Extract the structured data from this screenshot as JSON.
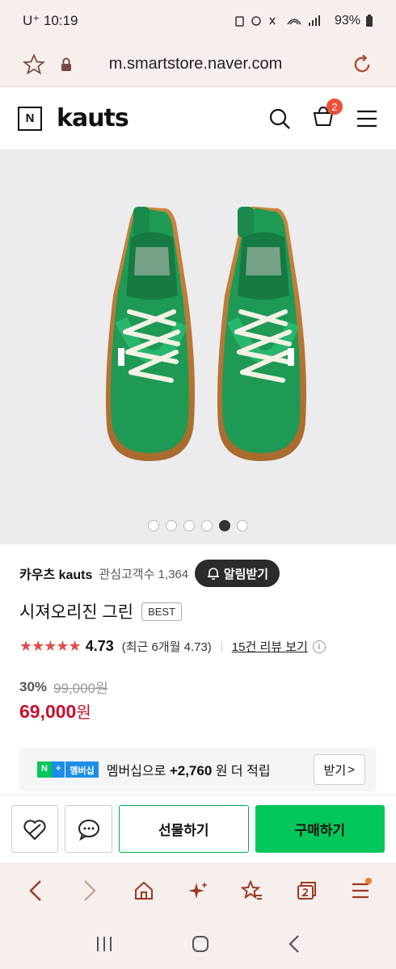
{
  "status": {
    "carrier_time": "U⁺ 10:19",
    "battery": "93%"
  },
  "browser": {
    "url": "m.smartstore.naver.com"
  },
  "header": {
    "n_logo": "N",
    "brand": "kauts",
    "cart_count": "2"
  },
  "gallery": {
    "total_images": 6,
    "active_index": 5
  },
  "store": {
    "name": "카우츠 kauts",
    "followers": "관심고객수 1,364",
    "alarm_label": "알림받기"
  },
  "product": {
    "title": "시져오리진 그린",
    "badge": "BEST",
    "stars": "★★★★★",
    "rating": "4.73",
    "recent_rating": "(최근 6개월 4.73)",
    "reviews_link": "15건 리뷰 보기",
    "info": "i",
    "discount": "30%",
    "original_price": "99,000원",
    "price": "69,000",
    "price_unit": "원"
  },
  "membership": {
    "badge_n": "N",
    "badge_plus": "+",
    "badge_label": "멤버십",
    "prefix": "멤버십으로",
    "points": "+2,760",
    "suffix": "원 더 적립",
    "view_label": "받기",
    "view_arrow": ">"
  },
  "actions": {
    "gift_label": "선물하기",
    "buy_label": "구매하기"
  },
  "colors": {
    "brand_green": "#03c75a",
    "price_red": "#c8102e",
    "shoe_green": "#1e9a55"
  }
}
